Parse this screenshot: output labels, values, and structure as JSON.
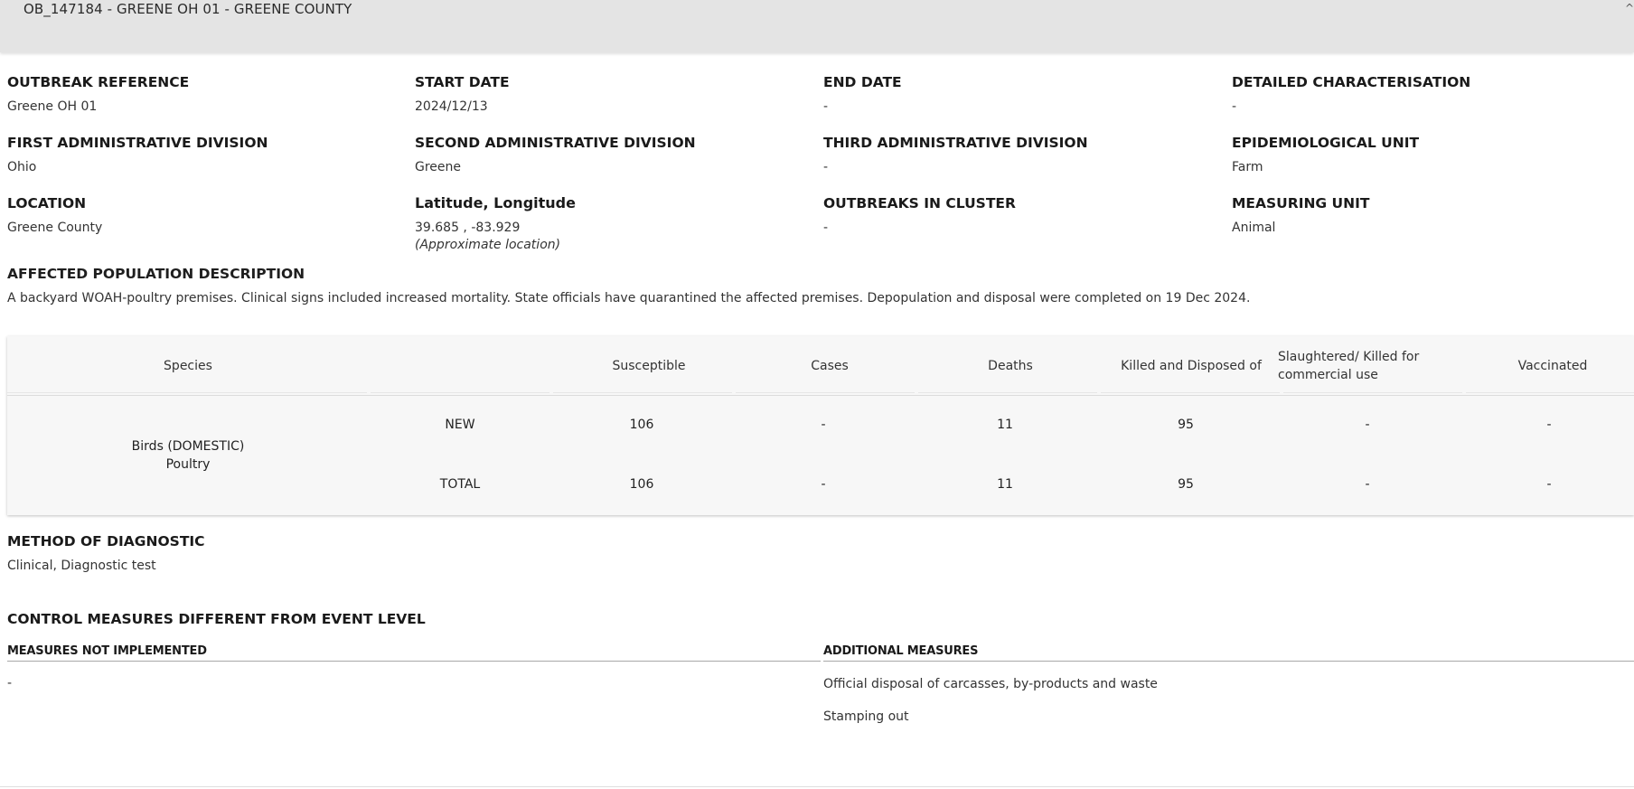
{
  "header": {
    "title": "OB_147184 - GREENE OH 01 - GREENE COUNTY",
    "toggle_icon": "chevron-up-icon"
  },
  "fields": {
    "outbreak_reference": {
      "label": "OUTBREAK REFERENCE",
      "value": "Greene OH 01"
    },
    "start_date": {
      "label": "START DATE",
      "value": "2024/12/13"
    },
    "end_date": {
      "label": "END DATE",
      "value": "-"
    },
    "detailed_characterisation": {
      "label": "DETAILED CHARACTERISATION",
      "value": "-"
    },
    "first_admin_division": {
      "label": "FIRST ADMINISTRATIVE DIVISION",
      "value": "Ohio"
    },
    "second_admin_division": {
      "label": "SECOND ADMINISTRATIVE DIVISION",
      "value": "Greene"
    },
    "third_admin_division": {
      "label": "THIRD ADMINISTRATIVE DIVISION",
      "value": "-"
    },
    "epidemiological_unit": {
      "label": "EPIDEMIOLOGICAL UNIT",
      "value": "Farm"
    },
    "location": {
      "label": "LOCATION",
      "value": "Greene County"
    },
    "lat_long": {
      "label": "Latitude, Longitude",
      "value": "39.685 , -83.929",
      "note": "(Approximate location)"
    },
    "outbreaks_in_cluster": {
      "label": "OUTBREAKS IN CLUSTER",
      "value": "-"
    },
    "measuring_unit": {
      "label": "MEASURING UNIT",
      "value": "Animal"
    }
  },
  "affected_population": {
    "label": "AFFECTED POPULATION DESCRIPTION",
    "text": "A backyard WOAH-poultry premises. Clinical signs included increased mortality. State officials have quarantined the affected premises. Depopulation and disposal were completed on 19 Dec 2024."
  },
  "table": {
    "headers": {
      "species": "Species",
      "susceptible": "Susceptible",
      "cases": "Cases",
      "deaths": "Deaths",
      "killed_disposed": "Killed and Disposed of",
      "slaughtered_line1": "Slaughtered/ Killed for",
      "slaughtered_line2": "commercial use",
      "vaccinated": "Vaccinated"
    },
    "species_line1": "Birds (DOMESTIC)",
    "species_line2": "Poultry",
    "rows": [
      {
        "type": "NEW",
        "susceptible": "106",
        "cases": "-",
        "deaths": "11",
        "killed_disposed": "95",
        "slaughtered": "-",
        "vaccinated": "-"
      },
      {
        "type": "TOTAL",
        "susceptible": "106",
        "cases": "-",
        "deaths": "11",
        "killed_disposed": "95",
        "slaughtered": "-",
        "vaccinated": "-"
      }
    ]
  },
  "method_of_diagnostic": {
    "label": "METHOD OF DIAGNOSTIC",
    "value": "Clinical, Diagnostic test"
  },
  "control_measures": {
    "label": "CONTROL MEASURES DIFFERENT FROM EVENT LEVEL",
    "not_implemented_label": "MEASURES NOT IMPLEMENTED",
    "not_implemented_value": "-",
    "additional_label": "ADDITIONAL MEASURES",
    "additional_items": [
      "Official disposal of carcasses, by-products and waste",
      "Stamping out"
    ]
  }
}
